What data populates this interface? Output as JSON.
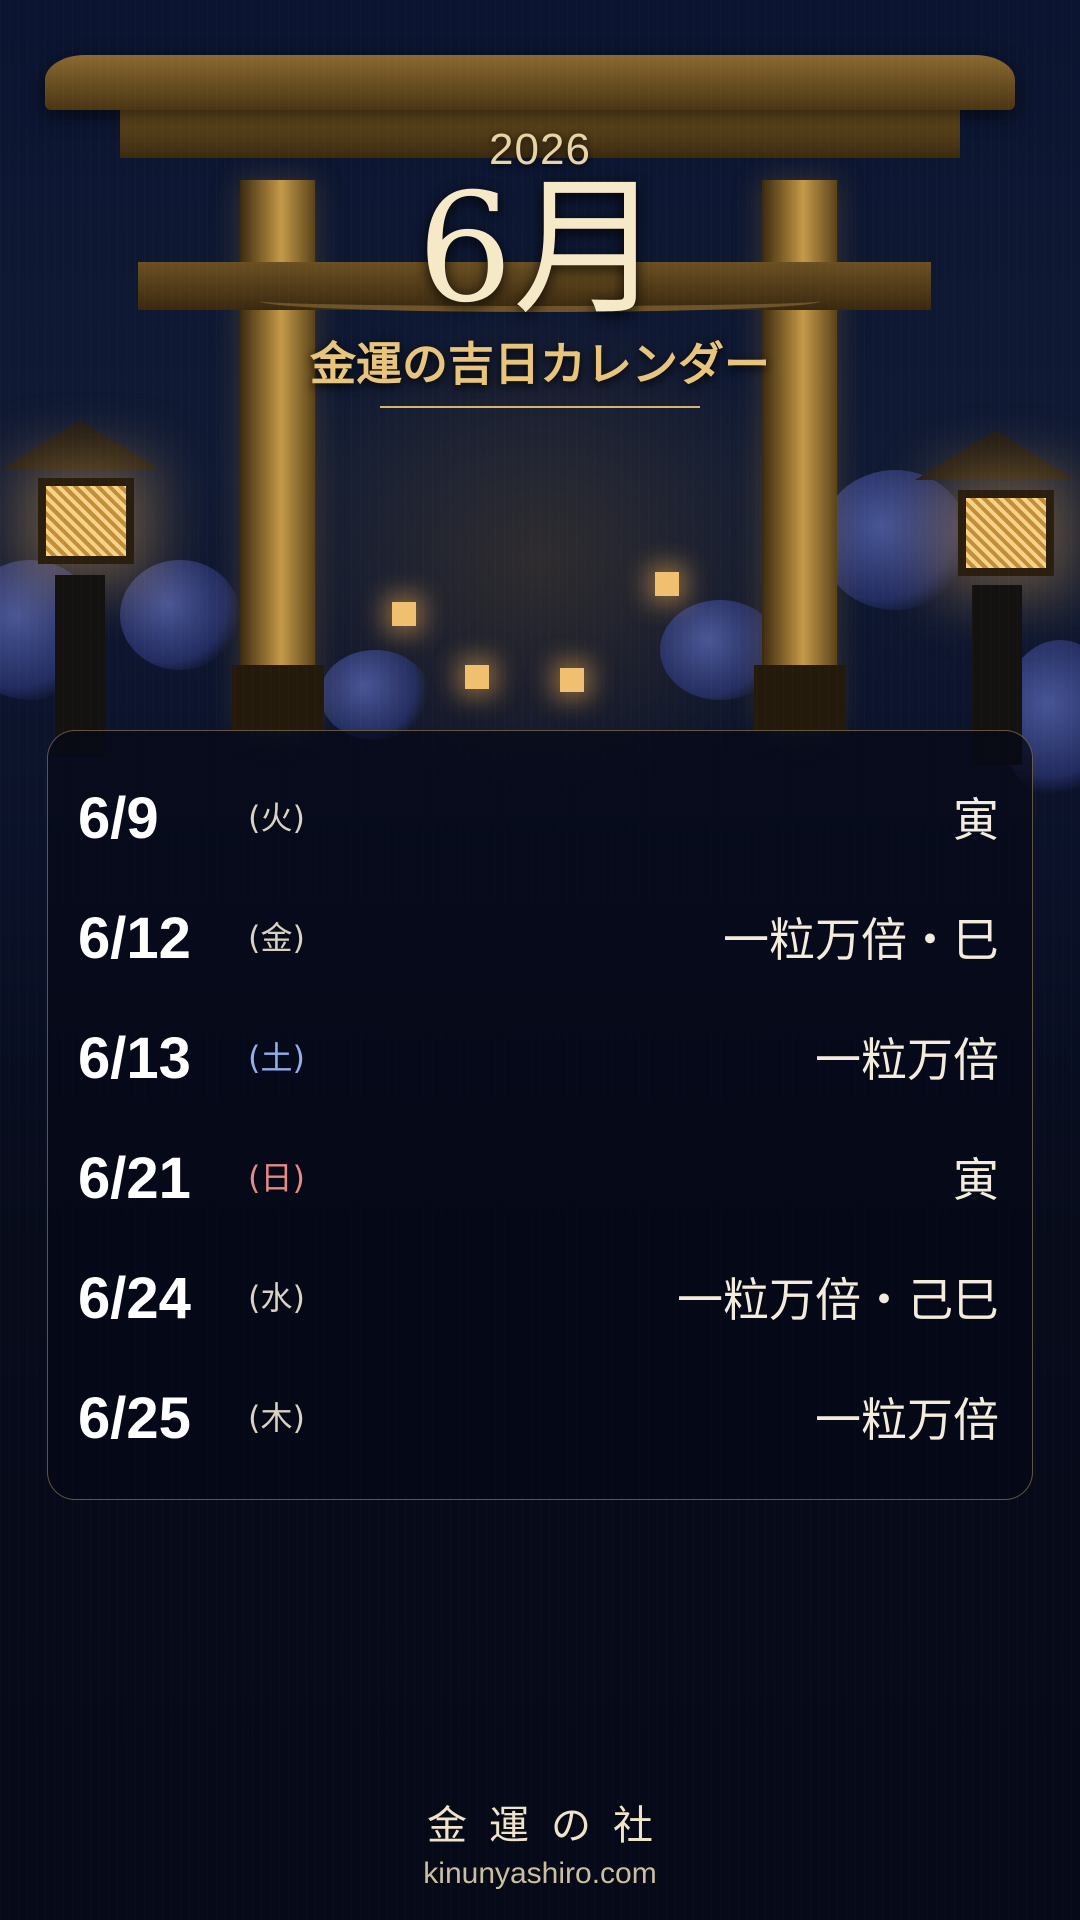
{
  "header": {
    "year": "2026",
    "month": "6月",
    "subtitle": "金運の吉日カレンダー"
  },
  "days": [
    {
      "date": "6/9",
      "dow": "(火)",
      "label": "寅"
    },
    {
      "date": "6/12",
      "dow": "(金)",
      "label": "一粒万倍・巳"
    },
    {
      "date": "6/13",
      "dow": "(土)",
      "label": "一粒万倍"
    },
    {
      "date": "6/21",
      "dow": "(日)",
      "label": "寅"
    },
    {
      "date": "6/24",
      "dow": "(水)",
      "label": "一粒万倍・己巳"
    },
    {
      "date": "6/25",
      "dow": "(木)",
      "label": "一粒万倍"
    }
  ],
  "footer": {
    "brand": "金運の社",
    "url": "kinunyashiro.com"
  },
  "colors": {
    "gold": "#e9c57c",
    "saturday": "#8fb0ea",
    "sunday": "#e58a84"
  }
}
